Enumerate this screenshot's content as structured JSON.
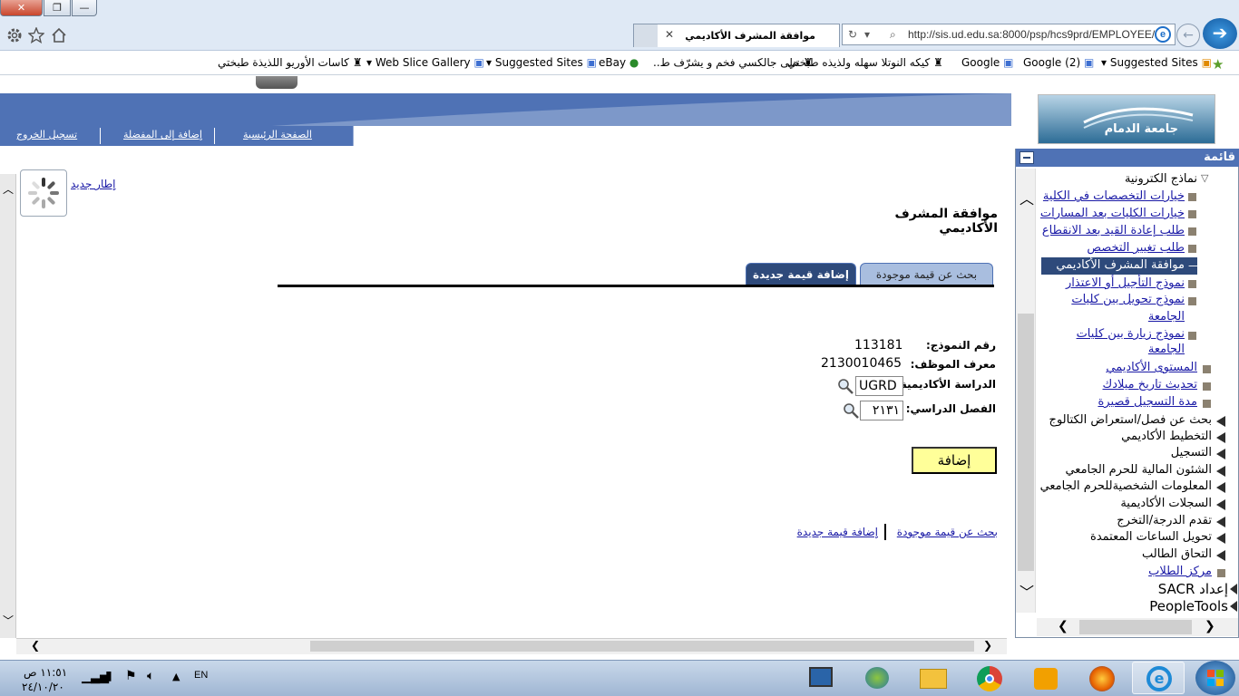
{
  "browser": {
    "address_url": "http://sis.ud.edu.sa:8000/psp/hcs9prd/EMPLOYEE/",
    "tab_title": "موافقة المشرف الأكاديمي",
    "favorites": [
      {
        "label": "Suggested Sites",
        "icon": "suggested-sites-icon"
      },
      {
        "label": "(Google (2",
        "icon": "google-icon"
      },
      {
        "label": "Google",
        "icon": "google-icon"
      },
      {
        "label": "كيكه النوتلا سهله ولذيذه  طبختي",
        "icon": "chef-icon"
      },
      {
        "label": "حلى جالكسي فخم و يشرّف  ط..",
        "icon": "chef-icon"
      },
      {
        "label": "eBay",
        "icon": "globe-icon"
      },
      {
        "label": "Suggested Sites",
        "icon": "ie-icon"
      },
      {
        "label": "Web Slice Gallery",
        "icon": "ie-icon"
      },
      {
        "label": "كاسات الأوريو اللذيذة  طبختي",
        "icon": "chef-icon"
      }
    ]
  },
  "header": {
    "logo_text": "جامعة الدمام",
    "nav": {
      "home": "الصفحة الرئيسية",
      "add_favorite": "إضافة إلى المفضلة",
      "logout": "تسجيل الخروج"
    }
  },
  "content": {
    "new_window": "إطار جديد",
    "page_title": "موافقة المشرف الأكاديمي",
    "tabs": {
      "search": "بحث عن قيمة موجودة",
      "add": "إضافة قيمة جديدة"
    },
    "fields": {
      "form_number_label": "رقم النموذج:",
      "form_number_value": "113181",
      "employee_id_label": "معرف الموظف:",
      "employee_id_value": "2130010465",
      "academic_career_label": "الدراسة الأكاديمية:",
      "academic_career_value": "UGRD",
      "term_label": "الفصل الدراسي:",
      "term_value": "٢١٣١"
    },
    "add_button": "إضافة",
    "bottom_links": {
      "search": "بحث عن قيمة موجودة",
      "add": "إضافة قيمة جديدة"
    }
  },
  "menu": {
    "title": "قائمة",
    "section": "نماذج الكترونية",
    "items": [
      "خيارات التخصصات في الكلية",
      "خيارات الكليات بعد المسارات",
      "طلب إعادة القيد بعد الانقطاع",
      "طلب تغيير التخصص",
      "موافقة المشرف الأكاديمي",
      "نموذج التأجيل أو الاعتذار",
      "نموذج تحويل بين كليات",
      "الجامعة",
      "نموذج زيارة بين كليات",
      "الجامعة"
    ],
    "links2": [
      "المستوى الأكاديمي",
      "تحديث تاريخ ميلادك",
      "مدة التسجيل قصيرة"
    ],
    "folders": [
      "بحث عن فصل/استعراض الكتالوج",
      "التخطيط الأكاديمي",
      "التسجيل",
      "الشئون المالية للحرم الجامعي",
      "المعلومات الشخصيةللحرم الجامعي",
      "السجلات الأكاديمية",
      "تقدم الدرجة/التخرج",
      "تحويل الساعات المعتمدة",
      "التحاق الطالب"
    ],
    "student_center": "مركز الطلاب",
    "sacr": "إعداد SACR",
    "peopletools": "PeopleTools"
  },
  "taskbar": {
    "time": "١١:٥١ ص",
    "date": "٢٤/١٠/٢٠",
    "lang": "EN"
  }
}
